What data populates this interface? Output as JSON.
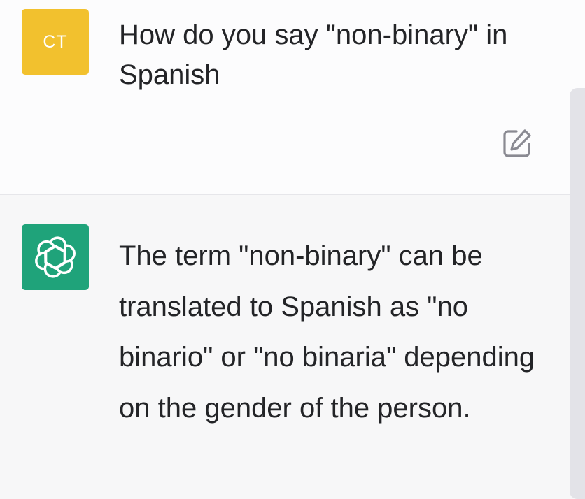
{
  "colors": {
    "user_avatar_bg": "#f2c12e",
    "assistant_avatar_bg": "#1fa37a",
    "edit_icon": "#8a8a92"
  },
  "user_message": {
    "avatar_initials": "CT",
    "text": "How do you say \"non-binary\" in Spanish",
    "edit_icon": "edit-icon"
  },
  "assistant_message": {
    "avatar_icon": "openai-logo-icon",
    "text": "The term \"non-binary\" can be translated to Spanish as \"no binario\" or \"no binaria\" depending on the gender of the person."
  }
}
